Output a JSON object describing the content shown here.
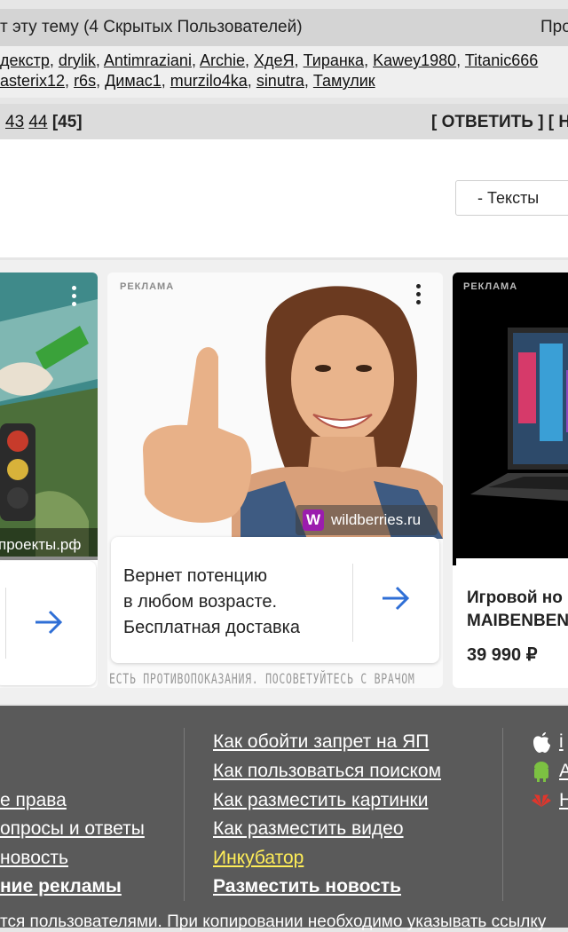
{
  "topic": {
    "left_text": "т эту тему (4 Скрытых Пользователей)",
    "right_text": "Про"
  },
  "users": {
    "line1": [
      "декстр",
      "drylik",
      "Antimraziani",
      "Archie",
      "ХдеЯ",
      "Тиранка",
      "Kawey1980",
      "Titanic666"
    ],
    "line2": [
      "asterix12",
      "r6s",
      "Димас1",
      "murzilo4ka",
      "sinutra",
      "Тамулик"
    ]
  },
  "pagination": {
    "pages": [
      "43",
      "44"
    ],
    "current": "[45]",
    "reply": "[ ОТВЕТИТЬ ] [ НО"
  },
  "filter": {
    "selected": "- Тексты"
  },
  "ads": {
    "ad1": {
      "domain": "проекты.рф"
    },
    "ad2": {
      "label": "РЕКЛАМА",
      "brand": "wildberries.ru",
      "line1": "Вернет потенцию",
      "line2": "в любом возрасте.",
      "line3": "Бесплатная доставка",
      "disclaimer": "ЕСТЬ ПРОТИВОПОКАЗАНИЯ. ПОСОВЕТУЙТЕСЬ С ВРАЧОМ"
    },
    "ad3": {
      "label": "РЕКЛАМА",
      "line1": "Игровой но",
      "line2": "MAIBENBEN",
      "price": "39 990 ₽"
    }
  },
  "footer": {
    "left_links": [
      "е права",
      "опросы и ответы",
      "новость",
      "ние рекламы"
    ],
    "middle_links": [
      "Как обойти запрет на ЯП",
      "Как пользоваться поиском",
      "Как разместить картинки",
      "Как разместить видео",
      "Инкубатор",
      "Разместить новость"
    ],
    "right_links": [
      "i",
      "A",
      "H"
    ],
    "copyright": "тся пользователями. При копировании необходимо указывать ссылку"
  },
  "colors": {
    "footer_bg": "#5a5a5a",
    "incubator": "#ffee58",
    "wb_purple": "#9b1dae",
    "arrow_blue": "#2f6fd6"
  }
}
